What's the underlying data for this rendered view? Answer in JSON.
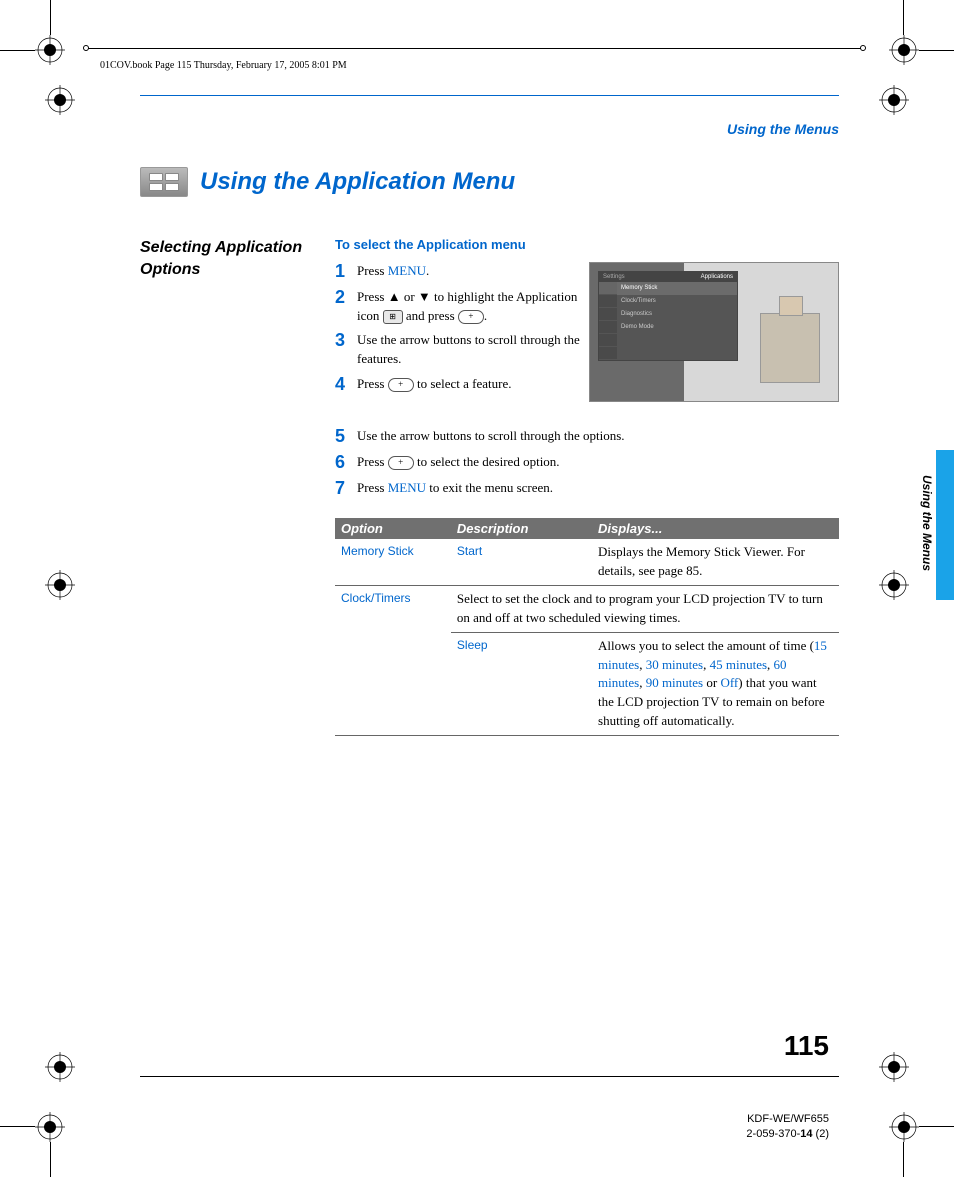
{
  "page_header": "01COV.book  Page 115  Thursday, February 17, 2005  8:01 PM",
  "header_label": "Using the Menus",
  "title": "Using the Application Menu",
  "section_heading": "Selecting Application Options",
  "subheading": "To select the Application menu",
  "steps": [
    {
      "n": "1",
      "pre": "Press ",
      "hl": "MENU",
      "post": "."
    },
    {
      "n": "2",
      "pre": "Press ",
      "arrows": true,
      "mid": " to highlight the Application icon ",
      "icon": "app",
      "post2": " and press ",
      "pill": true,
      "end": "."
    },
    {
      "n": "3",
      "pre": "Use the arrow buttons to scroll through the features."
    },
    {
      "n": "4",
      "pre": "Press ",
      "pill": true,
      "post": " to select a feature."
    },
    {
      "n": "5",
      "pre": "Use the arrow buttons to scroll through the options."
    },
    {
      "n": "6",
      "pre": "Press ",
      "pill": true,
      "post": " to select the desired option."
    },
    {
      "n": "7",
      "pre": "Press ",
      "hl": "MENU",
      "post": " to exit the menu screen."
    }
  ],
  "menu": {
    "left": "Settings",
    "right": "Applications",
    "items": [
      "Memory Stick",
      "Clock/Timers",
      "Diagnostics",
      "Demo Mode"
    ]
  },
  "table": {
    "headers": [
      "Option",
      "Description",
      "Displays..."
    ],
    "rows": [
      {
        "option": "Memory Stick",
        "desc": "Start",
        "disp": "Displays the Memory Stick Viewer. For details, see page 85.",
        "span": false
      },
      {
        "option": "Clock/Timers",
        "desc_full": "Select to set the clock and to program your LCD projection TV to turn on and off at two scheduled viewing times."
      },
      {
        "option": "",
        "desc": "Sleep",
        "disp_parts": {
          "t1": "Allows you to select the amount of time (",
          "h1": "15 minutes",
          "c1": ", ",
          "h2": "30 minutes",
          "c2": ", ",
          "h3": "45 minutes",
          "c3": ", ",
          "h4": "60 minutes",
          "c4": ", ",
          "h5": "90 minutes",
          "c5": " or ",
          "h6": "Off",
          "t2": ") that you want the LCD projection TV to remain on before shutting off automatically."
        }
      }
    ]
  },
  "side_label": "Using the Menus",
  "page_number": "115",
  "footer": {
    "line1": "KDF-WE/WF655",
    "line2a": "2-059-370-",
    "line2b": "14",
    "line2c": " (2)"
  }
}
